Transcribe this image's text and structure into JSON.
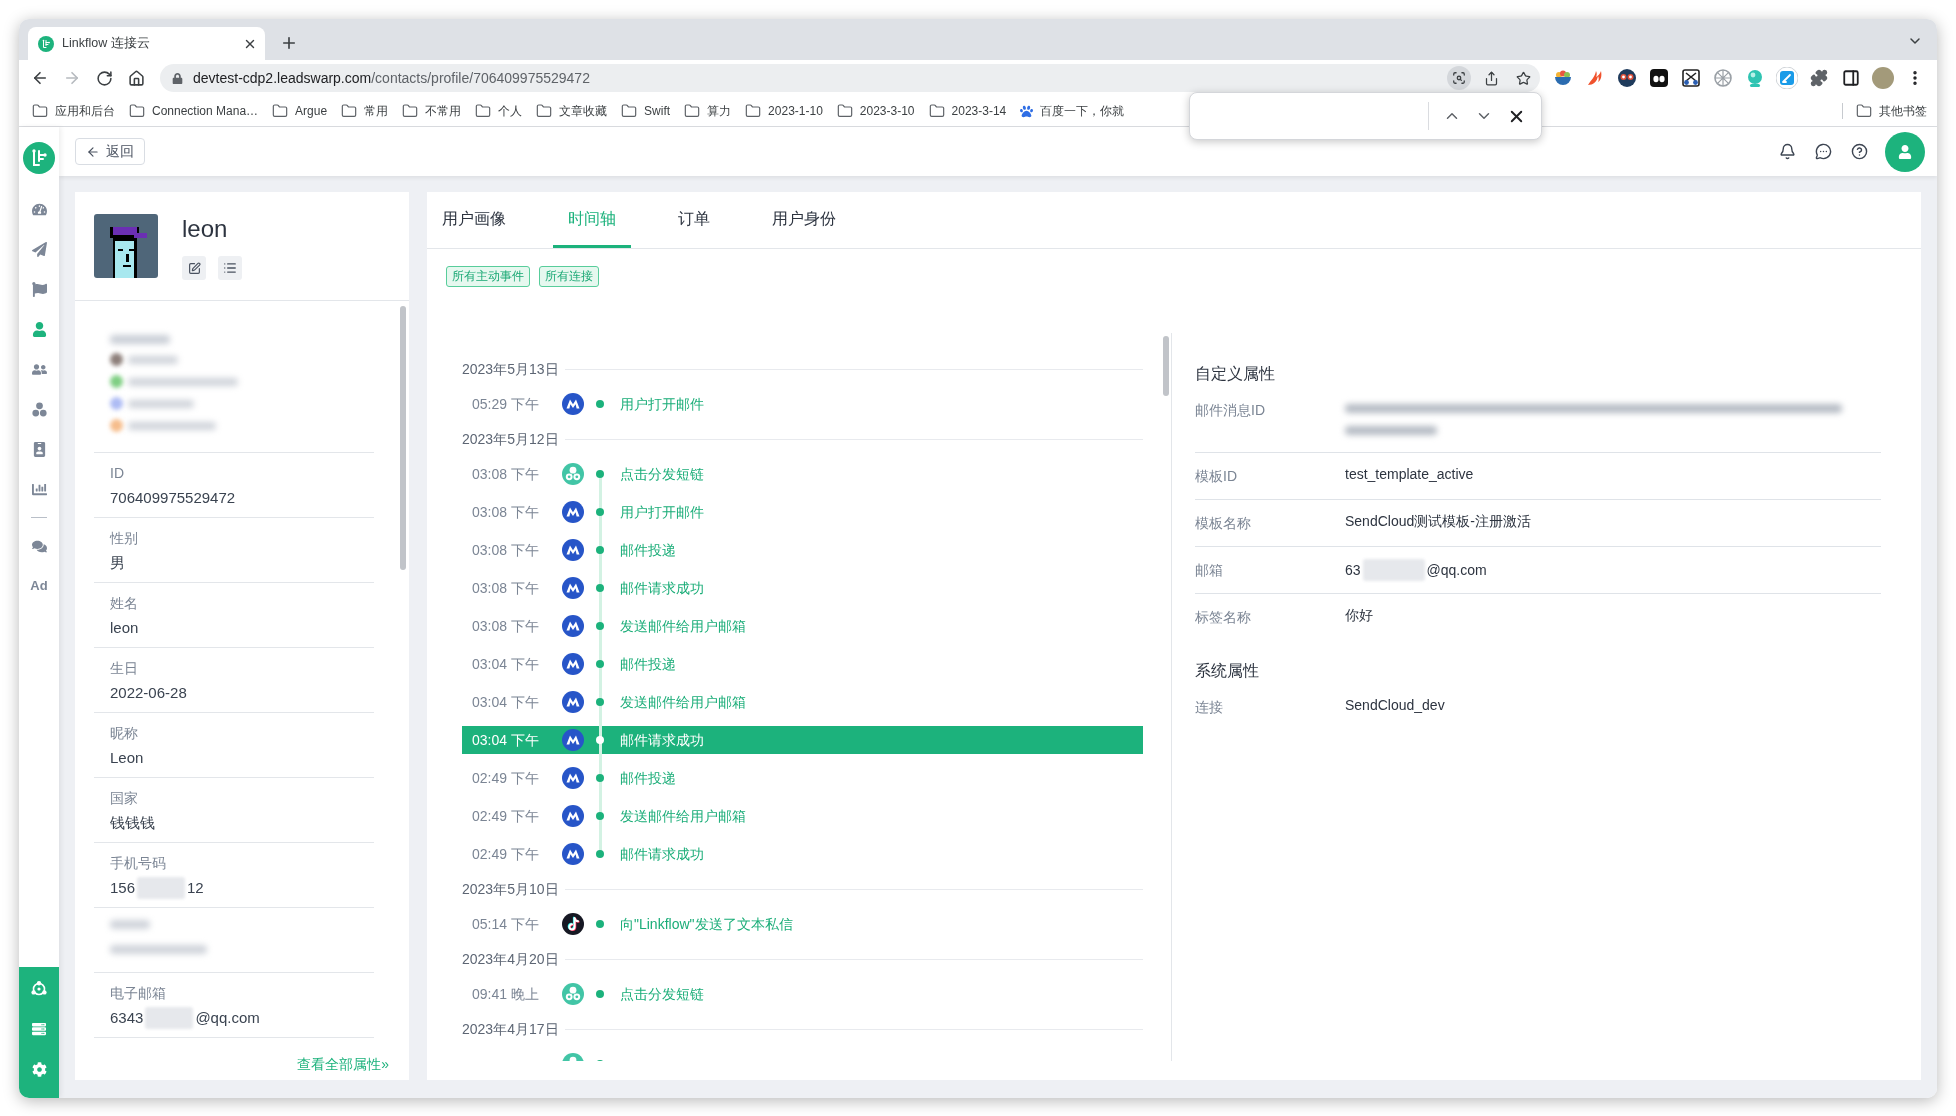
{
  "browser": {
    "tabs": [
      {
        "title": "Linkflow 连接云",
        "selected": true
      }
    ],
    "url_host": "devtest-cdp2.leadswarp.com",
    "url_path": "/contacts/profile/706409975529472",
    "bookmarks": [
      {
        "label": "应用和后台",
        "kind": "folder"
      },
      {
        "label": "Connection Mana…",
        "kind": "folder"
      },
      {
        "label": "Argue",
        "kind": "folder"
      },
      {
        "label": "常用",
        "kind": "folder"
      },
      {
        "label": "不常用",
        "kind": "folder"
      },
      {
        "label": "个人",
        "kind": "folder"
      },
      {
        "label": "文章收藏",
        "kind": "folder"
      },
      {
        "label": "Swift",
        "kind": "folder"
      },
      {
        "label": "算力",
        "kind": "folder"
      },
      {
        "label": "2023-1-10",
        "kind": "folder"
      },
      {
        "label": "2023-3-10",
        "kind": "folder"
      },
      {
        "label": "2023-3-14",
        "kind": "folder"
      },
      {
        "label": "百度一下，你就",
        "kind": "site"
      }
    ],
    "other_bookmarks": "其他书签",
    "find_bar": {
      "open": true
    }
  },
  "nav": {
    "groups": [
      [
        {
          "selected": false
        },
        {
          "selected": false
        },
        {
          "selected": false
        },
        {
          "selected": true
        },
        {
          "selected": false
        },
        {
          "selected": false
        },
        {
          "selected": false
        },
        {
          "selected": false
        }
      ],
      [
        {
          "selected": false
        },
        {
          "label": "Ad",
          "selected": false
        }
      ]
    ]
  },
  "header": {
    "back_button": "返回"
  },
  "profile": {
    "name": "leon",
    "attributes": [
      {
        "kind": "blurred_contacts"
      },
      {
        "kind": "field",
        "label": "ID",
        "value": "706409975529472"
      },
      {
        "kind": "field",
        "label": "性别",
        "value": "男"
      },
      {
        "kind": "field",
        "label": "姓名",
        "value": "leon"
      },
      {
        "kind": "field",
        "label": "生日",
        "value": "2022-06-28"
      },
      {
        "kind": "field",
        "label": "昵称",
        "value": "Leon"
      },
      {
        "kind": "field",
        "label": "国家",
        "value": "钱钱钱"
      },
      {
        "kind": "partly_blurred",
        "label": "手机号码",
        "value_before_blur": "156",
        "value_after_blur": "12"
      },
      {
        "kind": "blurred_field"
      },
      {
        "kind": "partly_blurred",
        "label": "电子邮箱",
        "value_before_blur": "6343",
        "value_after_blur": "@qq.com"
      }
    ],
    "view_all_link": "查看全部属性»"
  },
  "tabs": [
    {
      "label": "用户画像",
      "selected": false
    },
    {
      "label": "时间轴",
      "selected": true
    },
    {
      "label": "订单",
      "selected": false
    },
    {
      "label": "用户身份",
      "selected": false
    }
  ],
  "filters": [
    {
      "label": "所有主动事件"
    },
    {
      "label": "所有连接"
    }
  ],
  "timeline": [
    {
      "date": "2023年5月13日",
      "events": [
        {
          "time": "05:29 下午",
          "kind": "email",
          "label": "用户打开邮件",
          "selected": false
        }
      ]
    },
    {
      "date": "2023年5月12日",
      "events": [
        {
          "time": "03:08 下午",
          "kind": "short_link",
          "label": "点击分发短链",
          "selected": false
        },
        {
          "time": "03:08 下午",
          "kind": "email",
          "label": "用户打开邮件",
          "selected": false
        },
        {
          "time": "03:08 下午",
          "kind": "email",
          "label": "邮件投递",
          "selected": false
        },
        {
          "time": "03:08 下午",
          "kind": "email",
          "label": "邮件请求成功",
          "selected": false
        },
        {
          "time": "03:08 下午",
          "kind": "email",
          "label": "发送邮件给用户邮箱",
          "selected": false
        },
        {
          "time": "03:04 下午",
          "kind": "email",
          "label": "邮件投递",
          "selected": false
        },
        {
          "time": "03:04 下午",
          "kind": "email",
          "label": "发送邮件给用户邮箱",
          "selected": false
        },
        {
          "time": "03:04 下午",
          "kind": "email",
          "label": "邮件请求成功",
          "selected": true
        },
        {
          "time": "02:49 下午",
          "kind": "email",
          "label": "邮件投递",
          "selected": false
        },
        {
          "time": "02:49 下午",
          "kind": "email",
          "label": "发送邮件给用户邮箱",
          "selected": false
        },
        {
          "time": "02:49 下午",
          "kind": "email",
          "label": "邮件请求成功",
          "selected": false
        }
      ]
    },
    {
      "date": "2023年5月10日",
      "events": [
        {
          "time": "05:14 下午",
          "kind": "message",
          "label": "向\"Linkflow\"发送了文本私信",
          "selected": false
        }
      ]
    },
    {
      "date": "2023年4月20日",
      "events": [
        {
          "time": "09:41 晚上",
          "kind": "short_link",
          "label": "点击分发短链",
          "selected": false
        }
      ]
    },
    {
      "date": "2023年4月17日",
      "events": [
        {
          "kind": "short_link",
          "selected": false
        }
      ]
    }
  ],
  "details": {
    "sections": [
      {
        "title": "自定义属性",
        "rows": [
          {
            "kind": "blurred_value",
            "label": "邮件消息ID"
          },
          {
            "kind": "field",
            "label": "模板ID",
            "value": "test_template_active"
          },
          {
            "kind": "field",
            "label": "模板名称",
            "value": "SendCloud测试模板-注册激活"
          },
          {
            "kind": "partly_blurred",
            "label": "邮箱",
            "value_before_blur": "63",
            "value_after_blur": "@qq.com"
          },
          {
            "kind": "field",
            "label": "标签名称",
            "value": "你好"
          }
        ]
      },
      {
        "title": "系统属性",
        "rows": [
          {
            "kind": "field",
            "label": "连接",
            "value": "SendCloud_dev"
          }
        ]
      }
    ]
  }
}
